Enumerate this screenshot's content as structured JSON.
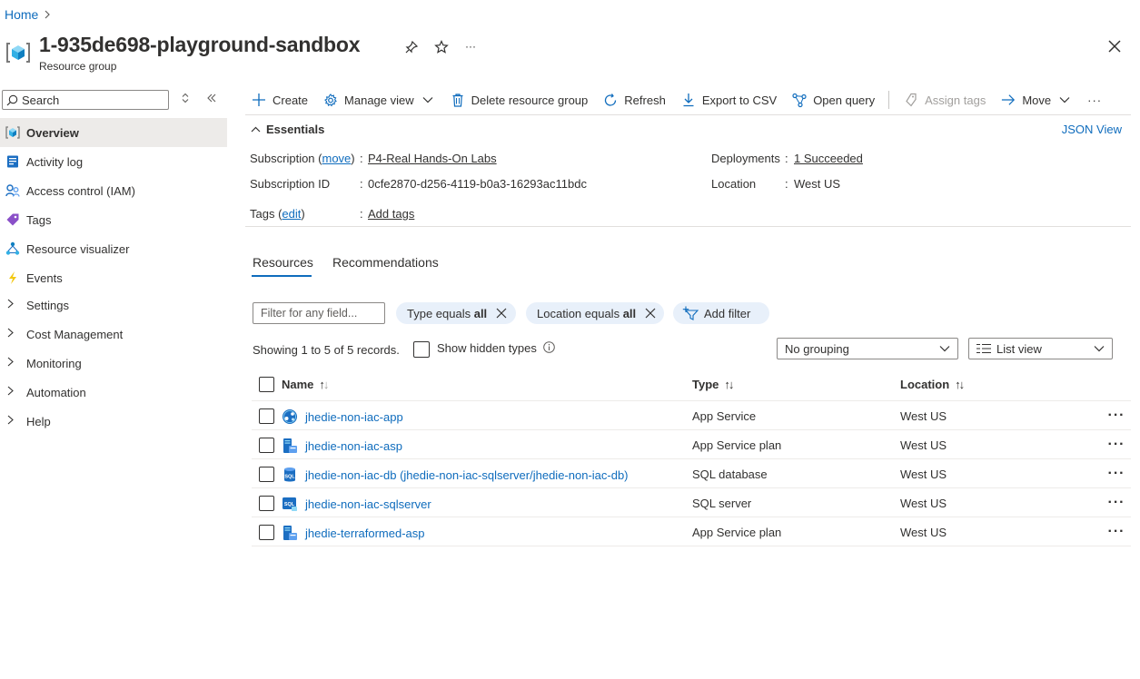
{
  "breadcrumb": {
    "home": "Home"
  },
  "header": {
    "title": "1-935de698-playground-sandbox",
    "subtitle": "Resource group"
  },
  "sidebar": {
    "search_placeholder": "Search",
    "items": [
      {
        "label": "Overview",
        "icon": "resource-group-icon",
        "selected": true
      },
      {
        "label": "Activity log",
        "icon": "activity-log-icon"
      },
      {
        "label": "Access control (IAM)",
        "icon": "iam-icon"
      },
      {
        "label": "Tags",
        "icon": "tag-icon"
      },
      {
        "label": "Resource visualizer",
        "icon": "visualizer-icon"
      },
      {
        "label": "Events",
        "icon": "lightning-icon"
      },
      {
        "label": "Settings",
        "expandable": true
      },
      {
        "label": "Cost Management",
        "expandable": true
      },
      {
        "label": "Monitoring",
        "expandable": true
      },
      {
        "label": "Automation",
        "expandable": true
      },
      {
        "label": "Help",
        "expandable": true
      }
    ]
  },
  "toolbar": {
    "create": "Create",
    "manage_view": "Manage view",
    "delete": "Delete resource group",
    "refresh": "Refresh",
    "export": "Export to CSV",
    "open_query": "Open query",
    "assign_tags": "Assign tags",
    "move": "Move",
    "more": "···"
  },
  "essentials": {
    "heading": "Essentials",
    "json_view": "JSON View",
    "subscription_label": "Subscription",
    "subscription_move": "move",
    "subscription_value": "P4-Real Hands-On Labs",
    "subscription_id_label": "Subscription ID",
    "subscription_id_value": "0cfe2870-d256-4119-b0a3-16293ac11bdc",
    "tags_label": "Tags",
    "tags_edit": "edit",
    "tags_value": "Add tags",
    "deployments_label": "Deployments",
    "deployments_value": "1 Succeeded",
    "location_label": "Location",
    "location_value": "West US",
    "colon": ":"
  },
  "tabs": [
    {
      "label": "Resources",
      "active": true
    },
    {
      "label": "Recommendations"
    }
  ],
  "filters": {
    "placeholder": "Filter for any field...",
    "type_pill_prefix": "Type equals ",
    "type_pill_value": "all",
    "location_pill_prefix": "Location equals ",
    "location_pill_value": "all",
    "add_filter": "Add filter"
  },
  "records": {
    "text": "Showing 1 to 5 of 5 records.",
    "show_hidden": "Show hidden types",
    "grouping": "No grouping",
    "view": "List view"
  },
  "table": {
    "columns": [
      "Name",
      "Type",
      "Location"
    ],
    "rows": [
      {
        "name": "jhedie-non-iac-app",
        "type": "App Service",
        "location": "West US",
        "icon": "app-service-icon"
      },
      {
        "name": "jhedie-non-iac-asp",
        "type": "App Service plan",
        "location": "West US",
        "icon": "app-service-plan-icon"
      },
      {
        "name": "jhedie-non-iac-db (jhedie-non-iac-sqlserver/jhedie-non-iac-db)",
        "type": "SQL database",
        "location": "West US",
        "icon": "sql-database-icon"
      },
      {
        "name": "jhedie-non-iac-sqlserver",
        "type": "SQL server",
        "location": "West US",
        "icon": "sql-server-icon"
      },
      {
        "name": "jhedie-terraformed-asp",
        "type": "App Service plan",
        "location": "West US",
        "icon": "app-service-plan-icon"
      }
    ]
  },
  "colors": {
    "accent": "#0f6cbd",
    "pill_bg": "#e8f0fa",
    "selected_bg": "#edebe9"
  }
}
